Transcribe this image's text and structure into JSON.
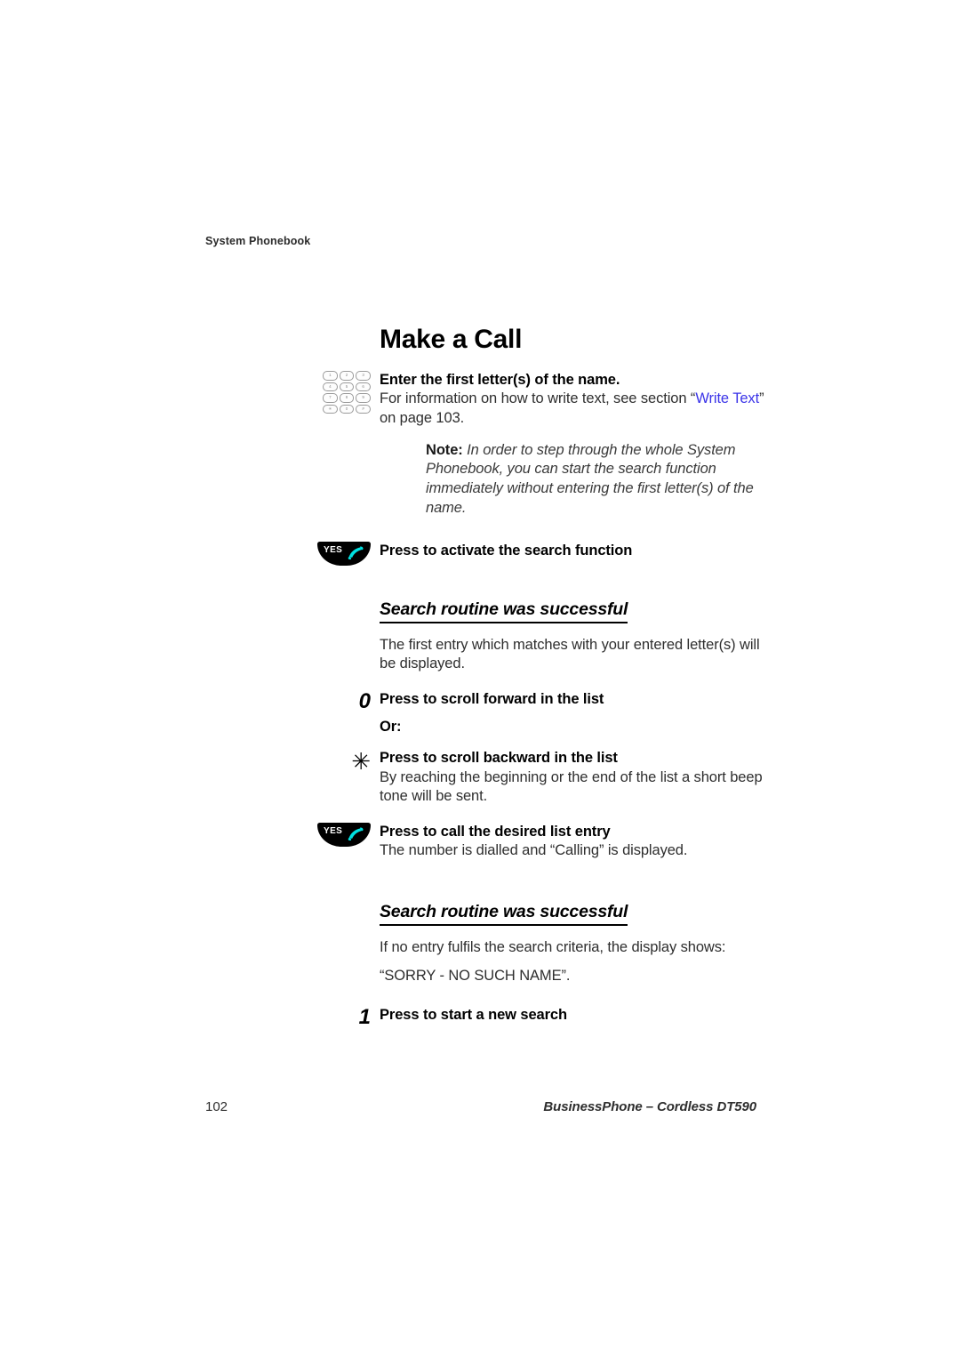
{
  "header": {
    "running_head": "System Phonebook"
  },
  "main": {
    "title": "Make a Call",
    "steps": [
      {
        "icon": "keypad-icon",
        "lead": "Enter the first letter(s) of the name.",
        "body_pre": "For information on how to write text, see section “",
        "link": "Write Text",
        "body_post": "” on page 103.",
        "note_label": "Note:",
        "note_text": " In order to step through the whole System Phonebook, you can start the search function immediately without entering the first letter(s) of the name."
      },
      {
        "icon": "yes-button-icon",
        "icon_label": "YES",
        "lead": "Press to activate the search function"
      }
    ],
    "section_one": {
      "heading": "Search routine was successful",
      "para": "The first entry which matches with your entered letter(s) will be displayed.",
      "steps": [
        {
          "key": "0",
          "key_type": "digit",
          "lead": "Press to scroll forward in the list",
          "or_label": "Or:"
        },
        {
          "key": "✳",
          "key_type": "star",
          "lead": "Press to scroll backward in the list",
          "para": "By reaching the beginning or the end of the list a short beep tone will be sent."
        },
        {
          "icon": "yes-button-icon",
          "icon_label": "YES",
          "lead": "Press to call the desired list entry",
          "para": "The number is dialled and “Calling” is displayed."
        }
      ]
    },
    "section_two": {
      "heading": "Search routine was successful",
      "para": "If no entry fulfils the search criteria, the display shows:",
      "display_text": "“SORRY - NO SUCH NAME”.",
      "steps": [
        {
          "key": "1",
          "key_type": "digit",
          "lead": "Press to start a new search"
        }
      ]
    }
  },
  "keypad": {
    "keys": [
      "1",
      "2",
      "3",
      "4",
      "5",
      "6",
      "7",
      "8",
      "9",
      "✳",
      "0",
      "#"
    ]
  },
  "footer": {
    "page_number": "102",
    "document_name": "BusinessPhone – Cordless DT590"
  },
  "colors": {
    "link": "#3b34e8",
    "handset": "#00e0e0",
    "button": "#000000",
    "text": "#1a1a1a"
  }
}
